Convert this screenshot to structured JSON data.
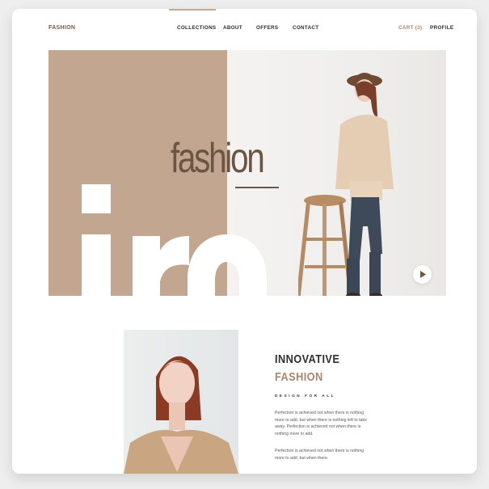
{
  "header": {
    "logo": "FASHION",
    "nav": [
      {
        "label": "COLLECTIONS"
      },
      {
        "label": "ABOUT"
      },
      {
        "label": "OFFERS"
      },
      {
        "label": "CONTACT"
      }
    ],
    "cart_label": "CART (3)",
    "profile_label": "PROFILE"
  },
  "hero": {
    "word": "fashion"
  },
  "feature": {
    "title_line1": "INNOVATIVE",
    "title_line2": "FASHION",
    "subtitle": "DESIGN FOR ALL",
    "paragraph1": "Perfection is achieved not when there is nothing more to add, but when there is nothing left to take away. Perfection is achieved not when there is nothing more to add.",
    "paragraph2": "Perfection is achieved not when there is nothing more to add, but when there."
  },
  "colors": {
    "accent": "#c2a68f",
    "brand_text": "#a8876c",
    "dark_brown": "#6b5646",
    "dark_text": "#2f2f33"
  }
}
